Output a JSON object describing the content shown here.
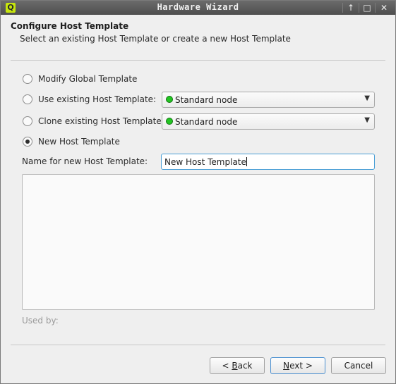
{
  "window": {
    "title": "Hardware Wizard",
    "app_icon_letter": "Q"
  },
  "header": {
    "title": "Configure Host Template",
    "subtitle": "Select an existing Host Template or create a new Host Template"
  },
  "options": [
    {
      "label": "Modify Global Template",
      "checked": false
    },
    {
      "label": "Use existing Host Template:",
      "checked": false,
      "combo_value": "Standard node"
    },
    {
      "label": "Clone existing Host Template:",
      "checked": false,
      "combo_value": "Standard node"
    },
    {
      "label": "New Host Template",
      "checked": true
    }
  ],
  "name_field": {
    "label": "Name for new Host Template:",
    "value": "New Host Template"
  },
  "used_by_label": "Used by:",
  "buttons": {
    "back_prefix": "< ",
    "back_mnemonic": "B",
    "back_rest": "ack",
    "next_mnemonic": "N",
    "next_rest": "ext >",
    "cancel": "Cancel"
  },
  "colors": {
    "status_dot": "#22c522",
    "focus_border": "#4a9fd6"
  }
}
